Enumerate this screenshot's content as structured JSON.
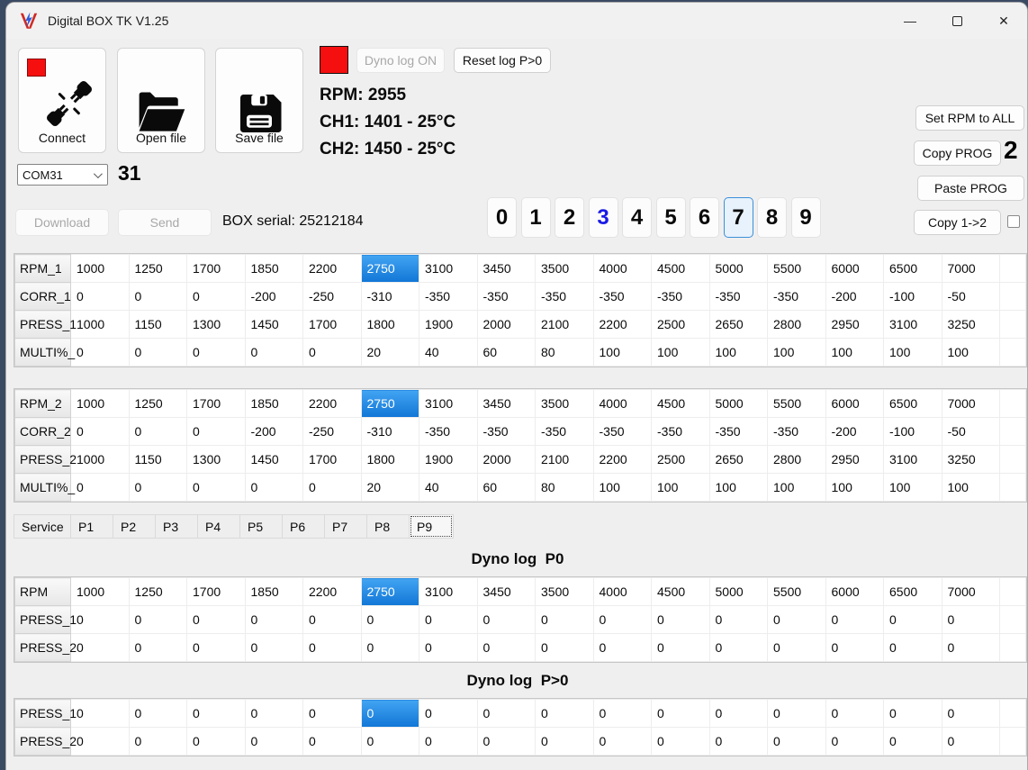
{
  "window": {
    "title": "Digital BOX TK V1.25",
    "minimize": "—",
    "close": "✕"
  },
  "toolbar": {
    "connect_label": "Connect",
    "open_label": "Open file",
    "save_label": "Save file"
  },
  "com": {
    "selected_port": "COM31",
    "port_number": "31"
  },
  "log_controls": {
    "dyno_log_on": "Dyno log ON",
    "reset_log": "Reset log P>0"
  },
  "telemetry": {
    "rpm": "RPM: 2955",
    "ch1": "CH1: 1401 - 25°C",
    "ch2": "CH2: 1450 - 25°C"
  },
  "right_panel": {
    "set_rpm_all": "Set RPM to ALL",
    "copy_prog": "Copy PROG",
    "copy_prog_count": "2",
    "paste_prog": "Paste PROG",
    "copy_1_2": "Copy 1->2",
    "copy_1_2_checked": false
  },
  "serial_row": {
    "download": "Download",
    "send": "Send",
    "box_serial": "BOX serial: 25212184"
  },
  "prog_digits": {
    "items": [
      "0",
      "1",
      "2",
      "3",
      "4",
      "5",
      "6",
      "7",
      "8",
      "9"
    ],
    "blue_digit": "3",
    "selected_digit": "7"
  },
  "colors": {
    "selection_blue": "#1176d6",
    "digit_blue": "#1a1ae6",
    "indicator_red": "#f50f0f"
  },
  "table1": {
    "rows": [
      {
        "header": "RPM_1",
        "selected": 5,
        "values": [
          "1000",
          "1250",
          "1700",
          "1850",
          "2200",
          "2750",
          "3100",
          "3450",
          "3500",
          "4000",
          "4500",
          "5000",
          "5500",
          "6000",
          "6500",
          "7000"
        ]
      },
      {
        "header": "CORR_1",
        "values": [
          "0",
          "0",
          "0",
          "-200",
          "-250",
          "-310",
          "-350",
          "-350",
          "-350",
          "-350",
          "-350",
          "-350",
          "-350",
          "-200",
          "-100",
          "-50"
        ]
      },
      {
        "header": "PRESS_1",
        "values": [
          "1000",
          "1150",
          "1300",
          "1450",
          "1700",
          "1800",
          "1900",
          "2000",
          "2100",
          "2200",
          "2500",
          "2650",
          "2800",
          "2950",
          "3100",
          "3250"
        ]
      },
      {
        "header": "MULTI%_",
        "values": [
          "0",
          "0",
          "0",
          "0",
          "0",
          "20",
          "40",
          "60",
          "80",
          "100",
          "100",
          "100",
          "100",
          "100",
          "100",
          "100"
        ]
      }
    ]
  },
  "table2": {
    "rows": [
      {
        "header": "RPM_2",
        "selected": 5,
        "values": [
          "1000",
          "1250",
          "1700",
          "1850",
          "2200",
          "2750",
          "3100",
          "3450",
          "3500",
          "4000",
          "4500",
          "5000",
          "5500",
          "6000",
          "6500",
          "7000"
        ]
      },
      {
        "header": "CORR_2",
        "values": [
          "0",
          "0",
          "0",
          "-200",
          "-250",
          "-310",
          "-350",
          "-350",
          "-350",
          "-350",
          "-350",
          "-350",
          "-350",
          "-200",
          "-100",
          "-50"
        ]
      },
      {
        "header": "PRESS_2",
        "values": [
          "1000",
          "1150",
          "1300",
          "1450",
          "1700",
          "1800",
          "1900",
          "2000",
          "2100",
          "2200",
          "2500",
          "2650",
          "2800",
          "2950",
          "3100",
          "3250"
        ]
      },
      {
        "header": "MULTI%_",
        "values": [
          "0",
          "0",
          "0",
          "0",
          "0",
          "20",
          "40",
          "60",
          "80",
          "100",
          "100",
          "100",
          "100",
          "100",
          "100",
          "100"
        ]
      }
    ]
  },
  "tabs": {
    "items": [
      "Service",
      "P1",
      "P2",
      "P3",
      "P4",
      "P5",
      "P6",
      "P7",
      "P8",
      "P9"
    ],
    "selected": "P9"
  },
  "dyno_p0": {
    "title": "Dyno log  P0",
    "rows": [
      {
        "header": "RPM",
        "selected": 5,
        "values": [
          "1000",
          "1250",
          "1700",
          "1850",
          "2200",
          "2750",
          "3100",
          "3450",
          "3500",
          "4000",
          "4500",
          "5000",
          "5500",
          "6000",
          "6500",
          "7000"
        ]
      },
      {
        "header": "PRESS_1",
        "values": [
          "0",
          "0",
          "0",
          "0",
          "0",
          "0",
          "0",
          "0",
          "0",
          "0",
          "0",
          "0",
          "0",
          "0",
          "0",
          "0"
        ]
      },
      {
        "header": "PRESS_2",
        "values": [
          "0",
          "0",
          "0",
          "0",
          "0",
          "0",
          "0",
          "0",
          "0",
          "0",
          "0",
          "0",
          "0",
          "0",
          "0",
          "0"
        ]
      }
    ]
  },
  "dyno_pgt0": {
    "title": "Dyno log  P>0",
    "rows": [
      {
        "header": "PRESS_1",
        "selected": 5,
        "values": [
          "0",
          "0",
          "0",
          "0",
          "0",
          "0",
          "0",
          "0",
          "0",
          "0",
          "0",
          "0",
          "0",
          "0",
          "0",
          "0"
        ]
      },
      {
        "header": "PRESS_2",
        "values": [
          "0",
          "0",
          "0",
          "0",
          "0",
          "0",
          "0",
          "0",
          "0",
          "0",
          "0",
          "0",
          "0",
          "0",
          "0",
          "0"
        ]
      }
    ]
  }
}
